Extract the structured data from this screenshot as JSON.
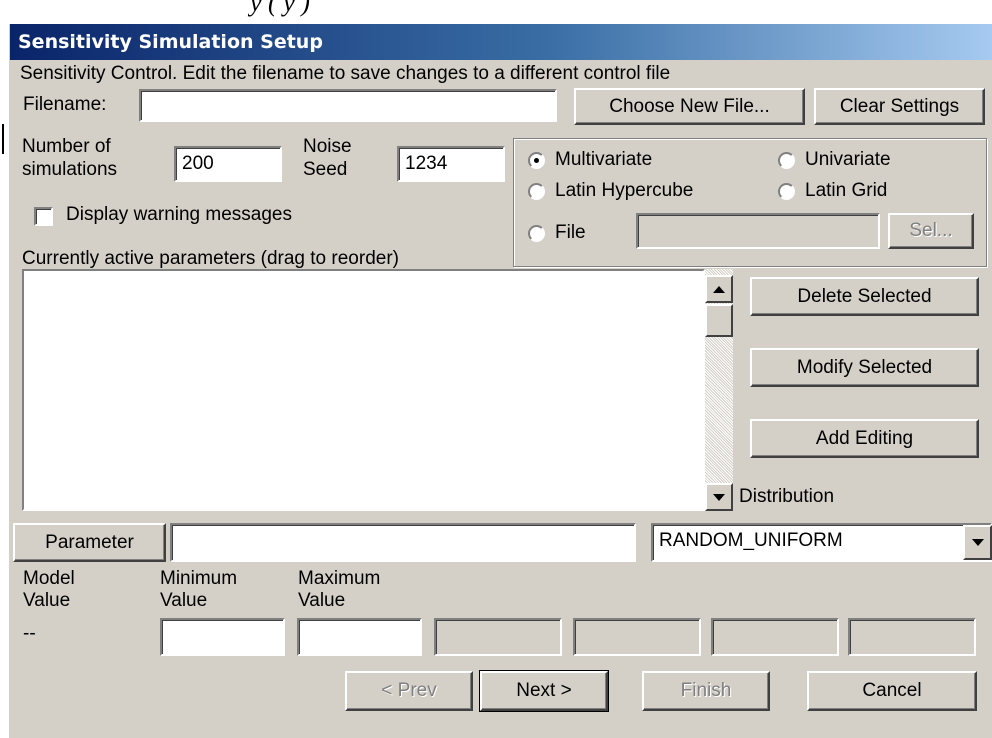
{
  "window": {
    "title": "Sensitivity Simulation Setup"
  },
  "header": {
    "description": "Sensitivity Control.  Edit the filename to save changes to a different control file"
  },
  "file": {
    "label": "Filename:",
    "value": "",
    "choose_button": "Choose New File...",
    "clear_button": "Clear Settings"
  },
  "simulation": {
    "count_label_line1": "Number of",
    "count_label_line2": "simulations",
    "count_value": "200",
    "seed_label_line1": "Noise",
    "seed_label_line2": "Seed",
    "seed_value": "1234",
    "warnings_label": "Display warning messages",
    "warnings_checked": false
  },
  "method": {
    "selected": "Multivariate",
    "options": {
      "multivariate": "Multivariate",
      "univariate": "Univariate",
      "latin_hypercube": "Latin Hypercube",
      "latin_grid": "Latin Grid",
      "file": "File"
    },
    "file_value": "",
    "sel_button": "Sel..."
  },
  "parameters": {
    "list_label": "Currently active parameters (drag to reorder)",
    "items": [],
    "delete_button": "Delete Selected",
    "modify_button": "Modify Selected",
    "add_button": "Add Editing",
    "distribution_label": "Distribution"
  },
  "editor": {
    "parameter_button": "Parameter",
    "parameter_value": "",
    "distribution_value": "RANDOM_UNIFORM",
    "model_value_label_line1": "Model",
    "model_value_label_line2": "Value",
    "model_value": "--",
    "min_label_line1": "Minimum",
    "min_label_line2": "Value",
    "max_label_line1": "Maximum",
    "max_label_line2": "Value",
    "min_value": "",
    "max_value": ""
  },
  "nav": {
    "prev": "< Prev",
    "next": "Next >",
    "finish": "Finish",
    "cancel": "Cancel"
  }
}
